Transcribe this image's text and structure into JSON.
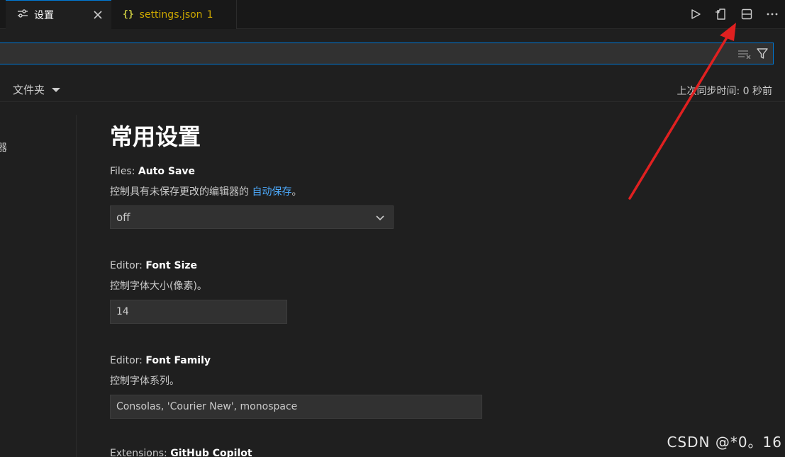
{
  "tabs": [
    {
      "label": "设置",
      "icon": "settings-sliders-icon"
    },
    {
      "label": "settings.json",
      "problems": "1",
      "icon": "json-braces-icon"
    }
  ],
  "toolbar": {
    "icons": [
      "run-icon",
      "open-settings-json-icon",
      "split-editor-icon",
      "more-actions-icon"
    ]
  },
  "search": {
    "value": "",
    "placeholder": ""
  },
  "scope": {
    "folder_label": "文件夹",
    "sync_status": "上次同步时间: 0 秒前"
  },
  "toc": {
    "partial_item": "器"
  },
  "page": {
    "title": "常用设置",
    "settings": [
      {
        "category": "Files: ",
        "name": "Auto Save",
        "desc_prefix": "控制具有未保存更改的编辑器的 ",
        "desc_link": "自动保存",
        "desc_suffix": "。",
        "value": "off"
      },
      {
        "category": "Editor: ",
        "name": "Font Size",
        "description": "控制字体大小(像素)。",
        "value": "14"
      },
      {
        "category": "Editor: ",
        "name": "Font Family",
        "description": "控制字体系列。",
        "value": "Consolas, 'Courier New', monospace"
      },
      {
        "category": "Extensions: ",
        "name": "GitHub Copilot"
      }
    ]
  },
  "annotation": {
    "arrow_color": "#e02020"
  },
  "watermark": "CSDN @*0。16"
}
